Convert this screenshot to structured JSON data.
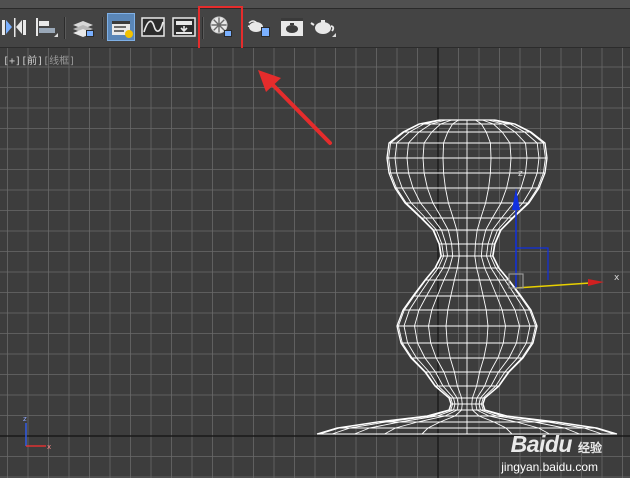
{
  "toolbar": {
    "buttons": [
      {
        "name": "mirror-button",
        "icon": "mirror-icon"
      },
      {
        "name": "align-button",
        "icon": "align-icon"
      },
      {
        "name": "layer-manager-button",
        "icon": "layer-icon"
      },
      {
        "name": "scene-explorer-button",
        "icon": "scene-explorer-icon",
        "active": true
      },
      {
        "name": "curve-editor-button",
        "icon": "curve-editor-icon"
      },
      {
        "name": "schematic-view-button",
        "icon": "schematic-icon"
      },
      {
        "name": "material-editor-button",
        "icon": "material-editor-icon"
      },
      {
        "name": "render-setup-button",
        "icon": "render-setup-icon"
      },
      {
        "name": "rendered-frame-window-button",
        "icon": "rendered-frame-icon"
      },
      {
        "name": "render-production-button",
        "icon": "teapot-icon"
      }
    ]
  },
  "viewport": {
    "label_plus": "[+]",
    "label_view": "[前]",
    "label_shading": "[线框]",
    "axis_x": "x",
    "axis_z": "z"
  },
  "watermark": {
    "brand": "Baidu",
    "sub": "经验",
    "url": "jingyan.baidu.com"
  },
  "colors": {
    "highlight": "#e52c2c",
    "arrow": "#e52c2c",
    "wire": "#ffffff",
    "gizmo_x": "#e8d000",
    "gizmo_z": "#1030e0",
    "grid": "#6e6e6e",
    "active_button": "#5a86b7"
  }
}
